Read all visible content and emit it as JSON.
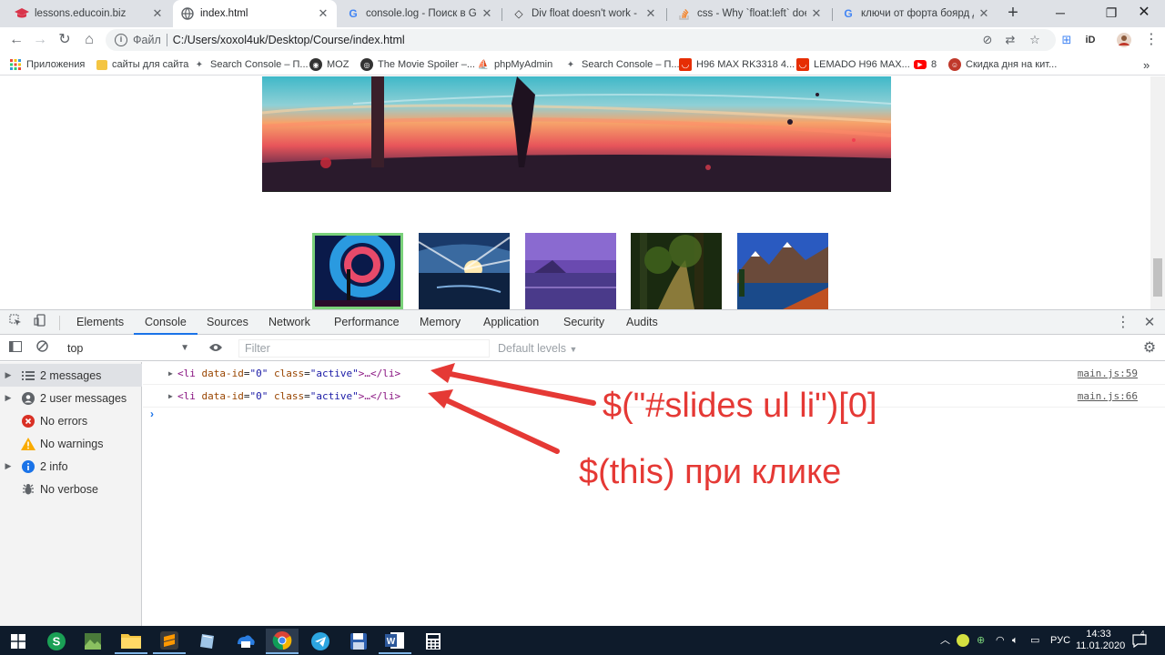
{
  "tabs": [
    {
      "title": "lessons.educoin.biz",
      "icon": "graduation-cap-icon",
      "active": false
    },
    {
      "title": "index.html",
      "icon": "globe-icon",
      "active": true
    },
    {
      "title": "console.log - Поиск в Google",
      "icon": "google-icon",
      "active": false
    },
    {
      "title": "Div float doesn't work - HTML",
      "icon": "code-icon",
      "active": false
    },
    {
      "title": "css - Why `float:left` doesn't w",
      "icon": "stackoverflow-icon",
      "active": false
    },
    {
      "title": "ключи от форта боярд дед",
      "icon": "google-icon",
      "active": false
    }
  ],
  "omnibox": {
    "scheme": "Файл",
    "url": "C:/Users/xoxol4uk/Desktop/Course/index.html"
  },
  "bookmarks": [
    {
      "label": "Приложения",
      "icon": "apps-grid-icon"
    },
    {
      "label": "сайты для сайта",
      "icon": "folder-icon"
    },
    {
      "label": "Search Console – П...",
      "icon": "search-console-icon"
    },
    {
      "label": "MOZ",
      "icon": "moz-icon"
    },
    {
      "label": "The Movie Spoiler –...",
      "icon": "globe-icon"
    },
    {
      "label": "phpMyAdmin",
      "icon": "phpmyadmin-icon"
    },
    {
      "label": "Search Console – П...",
      "icon": "search-console-icon"
    },
    {
      "label": "H96 MAX RK3318 4...",
      "icon": "aliexpress-icon"
    },
    {
      "label": "LEMADO H96 MAX...",
      "icon": "aliexpress-icon"
    },
    {
      "label": "8",
      "icon": "youtube-icon"
    },
    {
      "label": "Скидка дня на кит...",
      "icon": "avatar-icon"
    }
  ],
  "devtools": {
    "tabs": [
      "Elements",
      "Console",
      "Sources",
      "Network",
      "Performance",
      "Memory",
      "Application",
      "Security",
      "Audits"
    ],
    "active_tab": "Console",
    "context": "top",
    "filter_placeholder": "Filter",
    "levels": "Default levels",
    "sidebar": [
      {
        "label": "2 messages",
        "icon": "list-icon",
        "expandable": true,
        "selected": true
      },
      {
        "label": "2 user messages",
        "icon": "user-icon",
        "expandable": true,
        "selected": false
      },
      {
        "label": "No errors",
        "icon": "error-icon",
        "expandable": false,
        "selected": false
      },
      {
        "label": "No warnings",
        "icon": "warning-icon",
        "expandable": false,
        "selected": false
      },
      {
        "label": "2 info",
        "icon": "info-icon",
        "expandable": true,
        "selected": false
      },
      {
        "label": "No verbose",
        "icon": "bug-icon",
        "expandable": false,
        "selected": false
      }
    ],
    "messages": [
      {
        "tag_open": "<li",
        "attr1": "data-id",
        "val1": "\"0\"",
        "attr2": "class",
        "val2": "\"active\"",
        "rest": ">…</li>",
        "source": "main.js:59"
      },
      {
        "tag_open": "<li",
        "attr1": "data-id",
        "val1": "\"0\"",
        "attr2": "class",
        "val2": "\"active\"",
        "rest": ">…</li>",
        "source": "main.js:66"
      }
    ]
  },
  "annotations": {
    "first": "$(\"#slides ul li\")[0]",
    "second": "$(this) при клике",
    "color": "#e53935"
  },
  "taskbar": {
    "tray_lang": "РУС",
    "time": "14:33",
    "date": "11.01.2020",
    "notifications": "4"
  }
}
